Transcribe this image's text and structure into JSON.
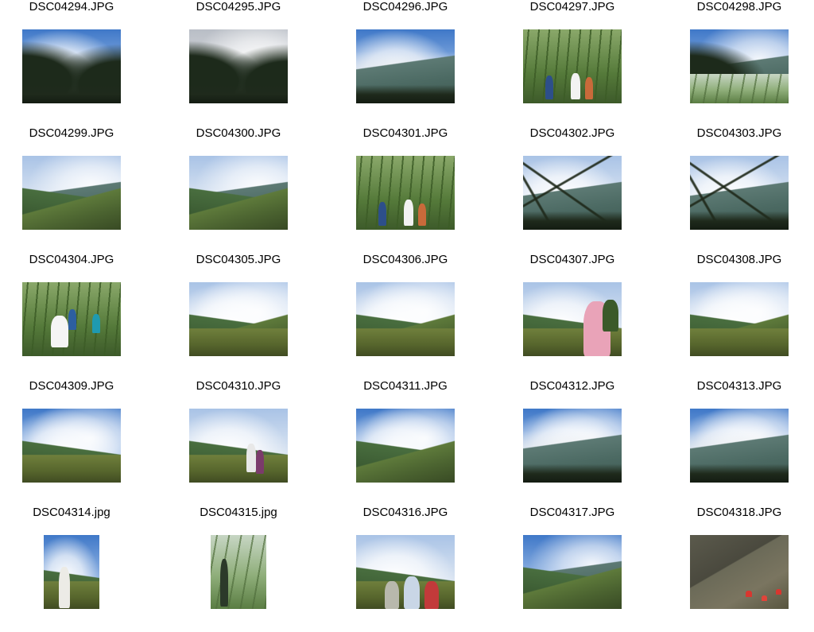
{
  "gallery": {
    "photos": [
      {
        "filename": "DSC04294.JPG",
        "orientation": "landscape",
        "scene": "sky-clouds-trees"
      },
      {
        "filename": "DSC04295.JPG",
        "orientation": "landscape",
        "scene": "grey-clouds-trees"
      },
      {
        "filename": "DSC04296.JPG",
        "orientation": "landscape",
        "scene": "cloud-sea"
      },
      {
        "filename": "DSC04297.JPG",
        "orientation": "landscape",
        "scene": "bamboo-hikers"
      },
      {
        "filename": "DSC04298.JPG",
        "orientation": "landscape",
        "scene": "valley-sky"
      },
      {
        "filename": "DSC04299.JPG",
        "orientation": "landscape",
        "scene": "valley-mountains"
      },
      {
        "filename": "DSC04300.JPG",
        "orientation": "landscape",
        "scene": "valley-mountains"
      },
      {
        "filename": "DSC04301.JPG",
        "orientation": "landscape",
        "scene": "bamboo-hikers"
      },
      {
        "filename": "DSC04302.JPG",
        "orientation": "landscape",
        "scene": "clouds-framed-branches"
      },
      {
        "filename": "DSC04303.JPG",
        "orientation": "landscape",
        "scene": "clouds-framed-branches"
      },
      {
        "filename": "DSC04304.JPG",
        "orientation": "landscape",
        "scene": "bamboo-path-hikers"
      },
      {
        "filename": "DSC04305.JPG",
        "orientation": "landscape",
        "scene": "green-ridge-clouds"
      },
      {
        "filename": "DSC04306.JPG",
        "orientation": "landscape",
        "scene": "green-ridge-clouds"
      },
      {
        "filename": "DSC04307.JPG",
        "orientation": "landscape",
        "scene": "portrait-hiker-clouds"
      },
      {
        "filename": "DSC04308.JPG",
        "orientation": "landscape",
        "scene": "green-ridge-clouds"
      },
      {
        "filename": "DSC04309.JPG",
        "orientation": "landscape",
        "scene": "cloud-over-ridge"
      },
      {
        "filename": "DSC04310.JPG",
        "orientation": "landscape",
        "scene": "trail-hikers"
      },
      {
        "filename": "DSC04311.JPG",
        "orientation": "landscape",
        "scene": "blue-sky-clouds"
      },
      {
        "filename": "DSC04312.JPG",
        "orientation": "landscape",
        "scene": "cloud-sea-blue"
      },
      {
        "filename": "DSC04313.JPG",
        "orientation": "landscape",
        "scene": "cloud-sea-blue"
      },
      {
        "filename": "DSC04314.jpg",
        "orientation": "portrait",
        "scene": "hiker-portrait-sky"
      },
      {
        "filename": "DSC04315.jpg",
        "orientation": "portrait",
        "scene": "hiker-portrait-grass"
      },
      {
        "filename": "DSC04316.JPG",
        "orientation": "landscape",
        "scene": "group-hikers-ridge"
      },
      {
        "filename": "DSC04317.JPG",
        "orientation": "landscape",
        "scene": "valley-blue-sky"
      },
      {
        "filename": "DSC04318.JPG",
        "orientation": "landscape",
        "scene": "rocky-slope-flowers"
      }
    ]
  }
}
